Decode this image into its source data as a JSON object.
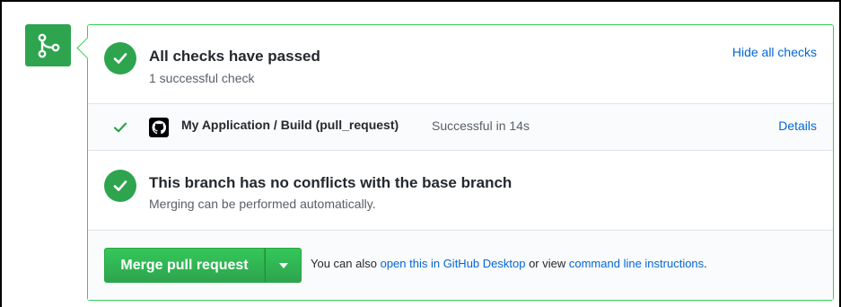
{
  "checks": {
    "title": "All checks have passed",
    "subtitle": "1 successful check",
    "hide_label": "Hide all checks"
  },
  "build": {
    "name": "My Application / Build (pull_request)",
    "status": "Successful in 14s",
    "details_label": "Details"
  },
  "conflicts": {
    "title": "This branch has no conflicts with the base branch",
    "subtitle": "Merging can be performed automatically."
  },
  "merge": {
    "button_label": "Merge pull request",
    "help_prefix": "You can also ",
    "desktop_link": "open this in GitHub Desktop",
    "help_middle": " or view ",
    "cli_link": "command line instructions",
    "help_suffix": "."
  },
  "colors": {
    "success": "#2ea44f",
    "link": "#0366d6",
    "border": "#34d058"
  },
  "icons": {
    "merge": "git-merge-icon",
    "check": "check-icon",
    "github": "github-icon",
    "caret": "triangle-down-icon"
  }
}
